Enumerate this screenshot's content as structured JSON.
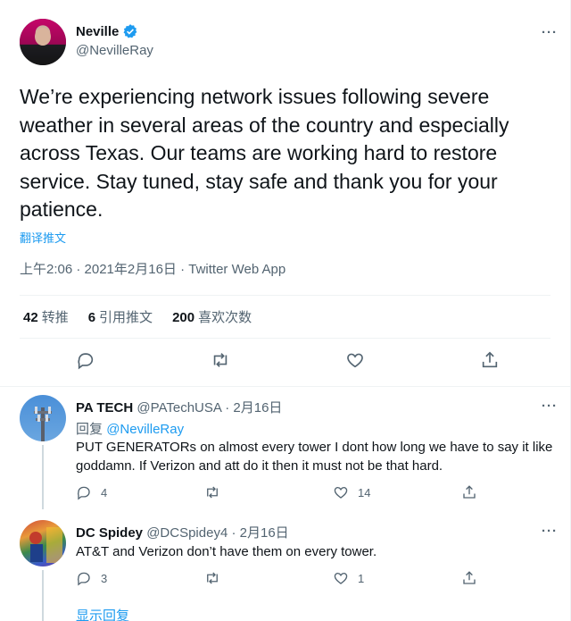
{
  "tweet": {
    "author_name": "Neville",
    "author_handle": "@NevilleRay",
    "text": "We’re experiencing network issues following severe weather in several areas of the country and especially across Texas. Our teams are working hard to restore service. Stay tuned, stay safe and thank you for your patience.",
    "translate_label": "翻译推文",
    "timestamp": "上午2:06 · 2021年2月16日 · Twitter Web App",
    "stats": {
      "retweets_count": "42",
      "retweets_label": "转推",
      "quotes_count": "6",
      "quotes_label": "引用推文",
      "likes_count": "200",
      "likes_label": "喜欢次数"
    },
    "more_label": "···"
  },
  "replies": [
    {
      "name": "PA TECH",
      "handle": "@PATechUSA",
      "date": "· 2月16日",
      "replying_prefix": "回复",
      "replying_to": "@NevilleRay",
      "text": "PUT GENERATORs on almost every tower I dont how long we have to say it like goddamn. If Verizon and att do it then it must not be that hard.",
      "reply_count": "4",
      "retweet_count": "",
      "like_count": "14",
      "more_label": "···"
    },
    {
      "name": "DC Spidey",
      "handle": "@DCSpidey4",
      "date": "· 2月16日",
      "text": "AT&T and Verizon don’t have them on every tower.",
      "reply_count": "3",
      "retweet_count": "",
      "like_count": "1",
      "more_label": "···"
    }
  ],
  "show_replies_label": "显示回复",
  "colors": {
    "accent": "#1d9bf0",
    "secondary_text": "#536471",
    "primary_text": "#0f1419"
  }
}
